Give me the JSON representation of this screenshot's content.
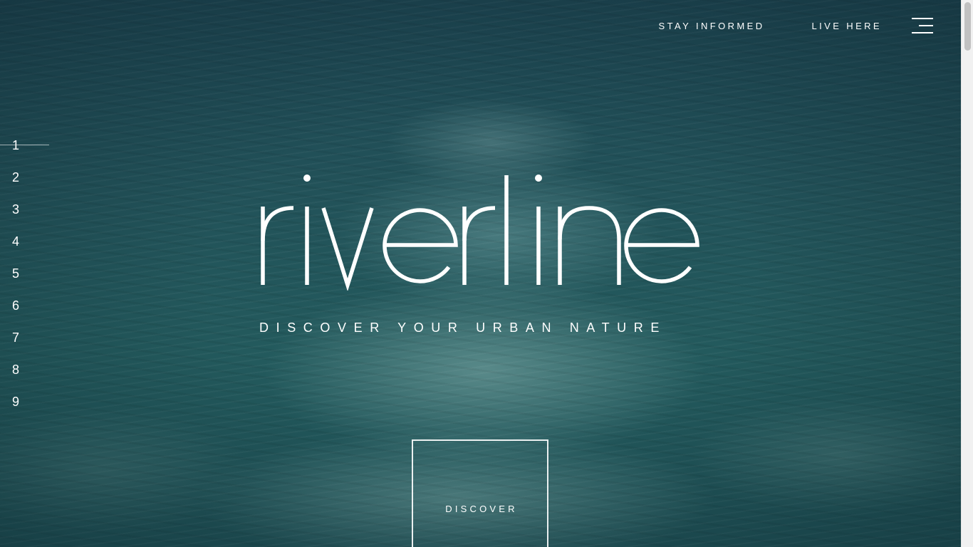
{
  "nav": {
    "stay_informed": "STAY INFORMED",
    "live_here": "LIVE HERE",
    "menu_icon": "hamburger-menu-icon"
  },
  "side_nav": {
    "items": [
      "1",
      "2",
      "3",
      "4",
      "5",
      "6",
      "7",
      "8",
      "9"
    ],
    "active_index": 0
  },
  "hero": {
    "logo_text": "riverline",
    "tagline": "DISCOVER YOUR URBAN NATURE",
    "discover_label": "DISCOVER",
    "background": "river water"
  },
  "colors": {
    "text": "#ffffff",
    "water_dark": "#1d4652",
    "water_mid": "#235a5d"
  }
}
